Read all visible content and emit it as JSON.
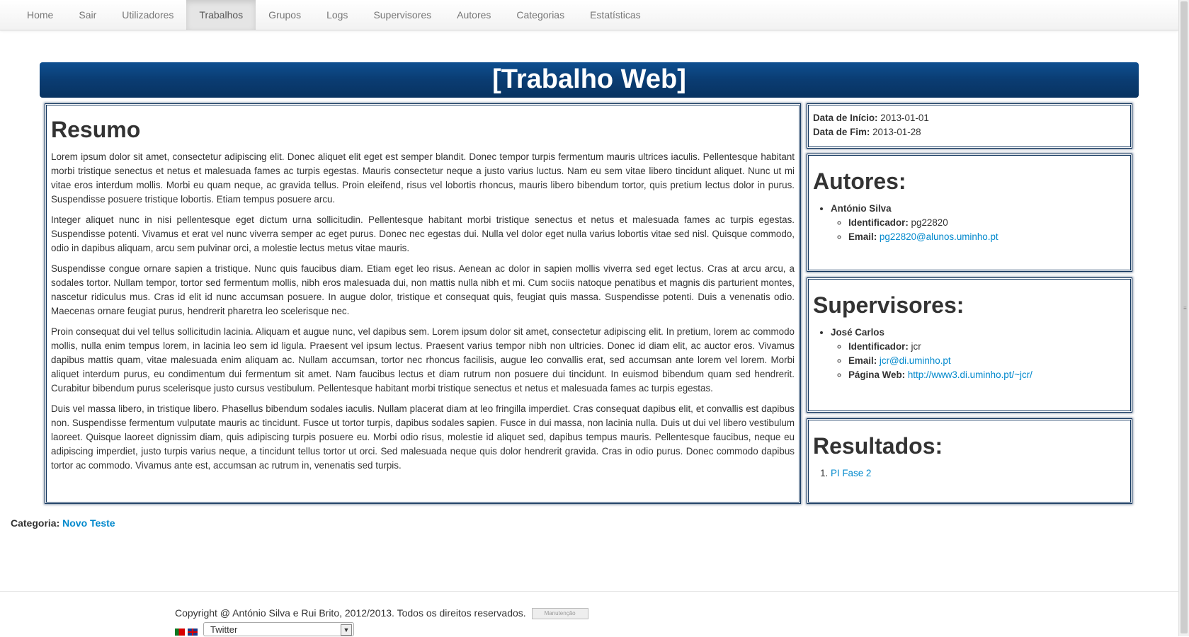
{
  "nav": {
    "items": [
      "Home",
      "Sair",
      "Utilizadores",
      "Trabalhos",
      "Grupos",
      "Logs",
      "Supervisores",
      "Autores",
      "Categorias",
      "Estatísticas"
    ],
    "active": "Trabalhos"
  },
  "page_title": "[Trabalho Web]",
  "resumo": {
    "heading": "Resumo",
    "paragraphs": [
      "Lorem ipsum dolor sit amet, consectetur adipiscing elit. Donec aliquet elit eget est semper blandit. Donec tempor turpis fermentum mauris ultrices iaculis. Pellentesque habitant morbi tristique senectus et netus et malesuada fames ac turpis egestas. Mauris consectetur neque a justo varius luctus. Nam eu sem vitae libero tincidunt aliquet. Nunc ut mi vitae eros interdum mollis. Morbi eu quam neque, ac gravida tellus. Proin eleifend, risus vel lobortis rhoncus, mauris libero bibendum tortor, quis pretium lectus dolor in purus. Suspendisse posuere tristique lobortis. Etiam tempus posuere arcu.",
      "Integer aliquet nunc in nisi pellentesque eget dictum urna sollicitudin. Pellentesque habitant morbi tristique senectus et netus et malesuada fames ac turpis egestas. Suspendisse potenti. Vivamus et erat vel nunc viverra semper ac eget purus. Donec nec egestas dui. Nulla vel dolor eget nulla varius lobortis vitae sed nisl. Quisque commodo, odio in dapibus aliquam, arcu sem pulvinar orci, a molestie lectus metus vitae mauris.",
      "Suspendisse congue ornare sapien a tristique. Nunc quis faucibus diam. Etiam eget leo risus. Aenean ac dolor in sapien mollis viverra sed eget lectus. Cras at arcu arcu, a sodales tortor. Nullam tempor, tortor sed fermentum mollis, nibh eros malesuada dui, non mattis nulla nibh et mi. Cum sociis natoque penatibus et magnis dis parturient montes, nascetur ridiculus mus. Cras id elit id nunc accumsan posuere. In augue dolor, tristique et consequat quis, feugiat quis massa. Suspendisse potenti. Duis a venenatis odio. Maecenas ornare feugiat purus, hendrerit pharetra leo scelerisque nec.",
      "Proin consequat dui vel tellus sollicitudin lacinia. Aliquam et augue nunc, vel dapibus sem. Lorem ipsum dolor sit amet, consectetur adipiscing elit. In pretium, lorem ac commodo mollis, nulla enim tempus lorem, in lacinia leo sem id ligula. Praesent vel ipsum lectus. Praesent varius tempor nibh non ultricies. Donec id diam elit, ac auctor eros. Vivamus dapibus mattis quam, vitae malesuada enim aliquam ac. Nullam accumsan, tortor nec rhoncus facilisis, augue leo convallis erat, sed accumsan ante lorem vel lorem. Morbi aliquet interdum purus, eu condimentum dui fermentum sit amet. Nam faucibus lectus et diam rutrum non posuere dui tincidunt. In euismod bibendum quam sed hendrerit. Curabitur bibendum purus scelerisque justo cursus vestibulum. Pellentesque habitant morbi tristique senectus et netus et malesuada fames ac turpis egestas.",
      "Duis vel massa libero, in tristique libero. Phasellus bibendum sodales iaculis. Nullam placerat diam at leo fringilla imperdiet. Cras consequat dapibus elit, et convallis est dapibus non. Suspendisse fermentum vulputate mauris ac tincidunt. Fusce ut tortor turpis, dapibus sodales sapien. Fusce in dui massa, non lacinia nulla. Duis ut dui vel libero vestibulum laoreet. Quisque laoreet dignissim diam, quis adipiscing turpis posuere eu. Morbi odio risus, molestie id aliquet sed, dapibus tempus mauris. Pellentesque faucibus, neque eu adipiscing imperdiet, justo turpis varius neque, a tincidunt tellus tortor ut orci. Sed malesuada neque quis dolor hendrerit gravida. Cras in odio purus. Donec commodo dapibus tortor ac commodo. Vivamus ante est, accumsan ac rutrum in, venenatis sed turpis."
    ]
  },
  "dates": {
    "start_label": "Data de Início:",
    "start_value": "2013-01-01",
    "end_label": "Data de Fim:",
    "end_value": "2013-01-28"
  },
  "autores": {
    "heading": "Autores:",
    "name": "António Silva",
    "id_label": "Identificador:",
    "id_value": "pg22820",
    "email_label": "Email:",
    "email_value": "pg22820@alunos.uminho.pt"
  },
  "supervisores": {
    "heading": "Supervisores:",
    "name": "José Carlos",
    "id_label": "Identificador:",
    "id_value": "jcr",
    "email_label": "Email:",
    "email_value": "jcr@di.uminho.pt",
    "web_label": "Página Web:",
    "web_value": "http://www3.di.uminho.pt/~jcr/"
  },
  "resultados": {
    "heading": "Resultados:",
    "items": [
      "PI Fase 2"
    ]
  },
  "categoria": {
    "label": "Categoria:",
    "value": "Novo Teste"
  },
  "footer": {
    "copyright": "Copyright @ António Silva e Rui Brito, 2012/2013. Todos os direitos reservados.",
    "badge": "Manutenção",
    "select_value": "Twitter"
  },
  "colors": {
    "title_bar": "#0a3c72",
    "link": "#0088cc",
    "panel_border": "#13365e"
  }
}
